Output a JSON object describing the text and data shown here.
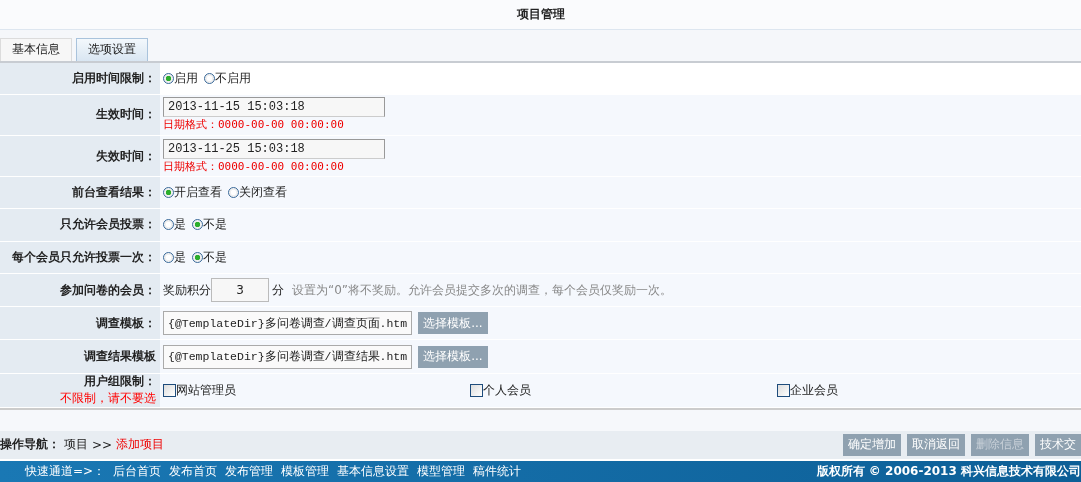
{
  "title": "项目管理",
  "tabs": [
    {
      "label": "基本信息",
      "selected": false
    },
    {
      "label": "选项设置",
      "selected": true
    }
  ],
  "rows": [
    {
      "kind": "radio",
      "label": "启用时间限制：",
      "options": [
        {
          "label": "启用",
          "selected": true
        },
        {
          "label": "不启用",
          "selected": false
        }
      ]
    },
    {
      "kind": "date",
      "label": "生效时间：",
      "value": "2013-11-15 15:03:18",
      "hint": "日期格式：0000-00-00 00:00:00"
    },
    {
      "kind": "date",
      "label": "失效时间：",
      "value": "2013-11-25 15:03:18",
      "hint": "日期格式：0000-00-00 00:00:00"
    },
    {
      "kind": "radio",
      "label": "前台查看结果：",
      "options": [
        {
          "label": "开启查看",
          "selected": true
        },
        {
          "label": "关闭查看",
          "selected": false
        }
      ]
    },
    {
      "kind": "radio",
      "label": "只允许会员投票：",
      "options": [
        {
          "label": "是",
          "selected": false
        },
        {
          "label": "不是",
          "selected": true
        }
      ]
    },
    {
      "kind": "radio",
      "label": "每个会员只允许投票一次：",
      "options": [
        {
          "label": "是",
          "selected": false
        },
        {
          "label": "不是",
          "selected": true
        }
      ]
    },
    {
      "kind": "points",
      "label": "参加问卷的会员：",
      "prefix": "奖励积分",
      "value": "3",
      "unit": "分",
      "note": "设置为“0”将不奖励。允许会员提交多次的调查，每个会员仅奖励一次。"
    },
    {
      "kind": "template",
      "label": "调查模板：",
      "value": "{@TemplateDir}多问卷调查/调查页面.htm",
      "button": "选择模板..."
    },
    {
      "kind": "template",
      "label": "调查结果模板",
      "value": "{@TemplateDir}多问卷调查/调查结果.htm",
      "button": "选择模板..."
    },
    {
      "kind": "groups",
      "label": "用户组限制：",
      "hint": "不限制，请不要选",
      "options": [
        {
          "label": "网站管理员",
          "checked": false
        },
        {
          "label": "个人会员",
          "checked": false
        },
        {
          "label": "企业会员",
          "checked": false
        }
      ]
    }
  ],
  "nav": {
    "label": "操作导航：",
    "path": "项目",
    "separator": ">>",
    "current": "添加项目"
  },
  "actions": [
    {
      "label": "确定增加",
      "disabled": false
    },
    {
      "label": "取消返回",
      "disabled": false
    },
    {
      "label": "删除信息",
      "disabled": true
    },
    {
      "label": "技术交",
      "disabled": false
    }
  ],
  "footer": {
    "label": "快速通道=>：",
    "links": [
      "后台首页",
      "发布首页",
      "发布管理",
      "模板管理",
      "基本信息设置",
      "模型管理",
      "稿件统计"
    ],
    "copyright": "版权所有 © 2006-2013 科兴信息技术有限公司"
  }
}
